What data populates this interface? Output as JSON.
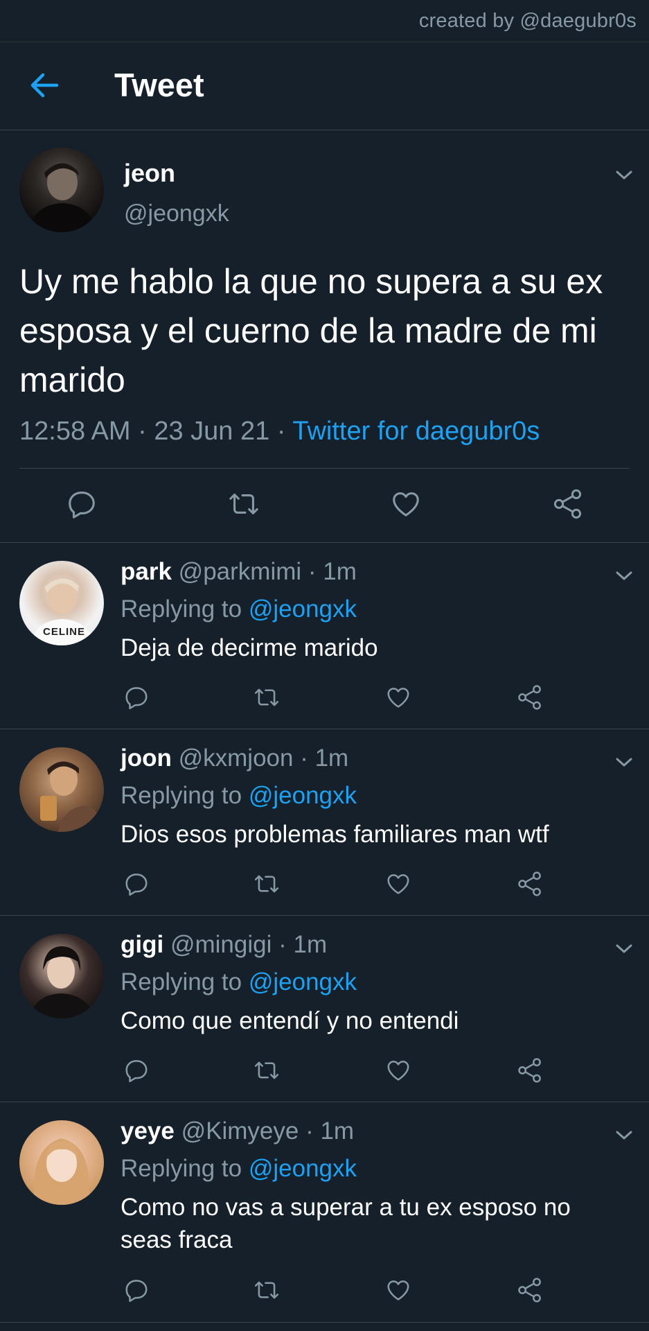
{
  "watermark": "created by @daegubr0s",
  "header": {
    "title": "Tweet",
    "back_icon": "arrow-left-icon"
  },
  "colors": {
    "background": "#15202b",
    "accent": "#1da1f2",
    "muted": "#8899a6",
    "divider": "#38444d"
  },
  "main_tweet": {
    "name": "jeon",
    "handle": "@jeongxk",
    "text": "Uy me hablo la que no supera a su ex esposa y el cuerno de la madre de mi marido",
    "time": "12:58 AM",
    "sep1": " · ",
    "date": "23 Jun 21",
    "sep2": " · ",
    "source": "Twitter for daegubr0s",
    "actions": [
      "reply-icon",
      "retweet-icon",
      "like-icon",
      "share-icon"
    ]
  },
  "replies": [
    {
      "name": "park",
      "handle": "@parkmimi",
      "time": " · 1m",
      "replying_label": "Replying to ",
      "mention": "@jeongxk",
      "text": "Deja de decirme marido",
      "avatar_text": "CELINE"
    },
    {
      "name": "joon",
      "handle": "@kxmjoon",
      "time": " · 1m",
      "replying_label": "Replying to ",
      "mention": "@jeongxk",
      "text": "Dios esos problemas familiares man wtf"
    },
    {
      "name": "gigi",
      "handle": "@mingigi",
      "time": " · 1m",
      "replying_label": "Replying to ",
      "mention": "@jeongxk",
      "text": "Como que entendí y no entendi"
    },
    {
      "name": "yeye",
      "handle": "@Kimyeye",
      "time": " · 1m",
      "replying_label": "Replying to ",
      "mention": "@jeongxk",
      "text": "Como no vas a superar a tu ex esposo no seas fraca"
    }
  ]
}
